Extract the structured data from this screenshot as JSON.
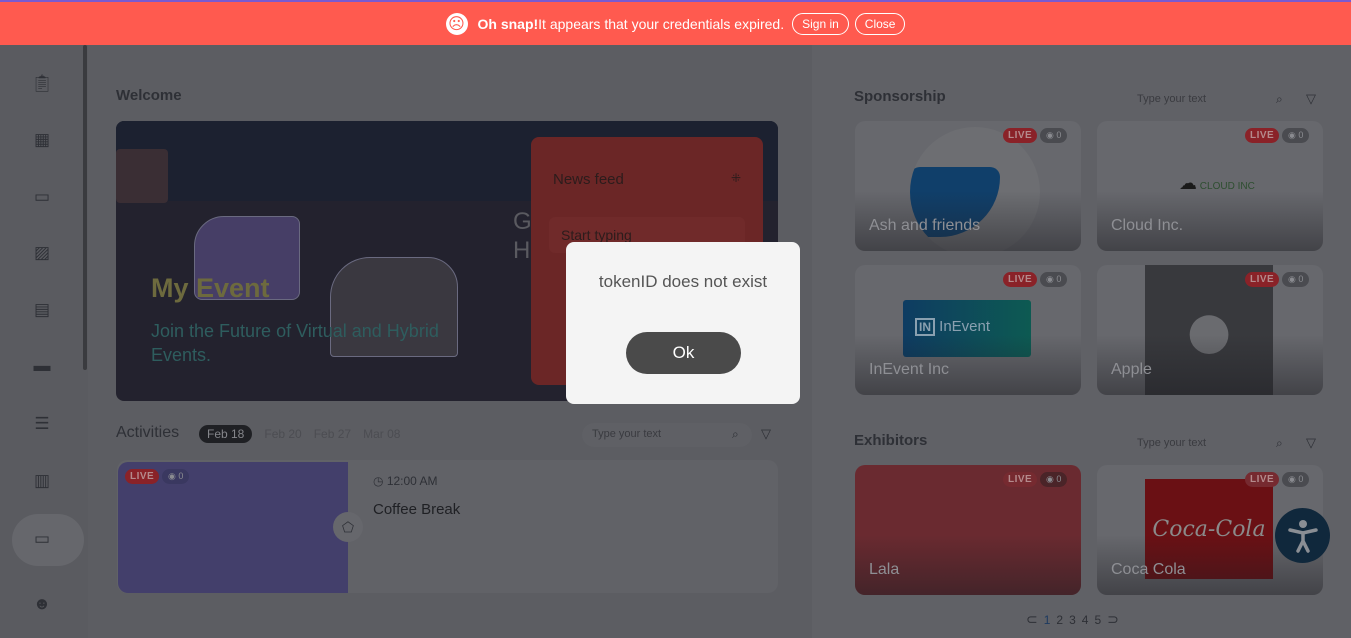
{
  "banner": {
    "strong": "Oh snap!",
    "message": " It appears that your credentials expired.",
    "sign_in": "Sign in",
    "close": "Close",
    "color": "#ff5a4f"
  },
  "sidebar": {
    "icons": [
      "clipboard-icon",
      "calendar-grid-icon",
      "calendar-icon",
      "image-icon",
      "id-card-icon",
      "ticket-icon",
      "chat-list-icon",
      "table-icon",
      "monitor-icon",
      "avatar"
    ],
    "active": "monitor-icon"
  },
  "welcome": {
    "title": "Welcome",
    "event_title": "My Event",
    "event_subtitle": "Join the Future of Virtual and Hybrid Events.",
    "partial_heading": "G\nH",
    "news_feed": {
      "title": "News feed",
      "placeholder": "Start typing"
    }
  },
  "activities": {
    "title": "Activities",
    "dates": [
      "Feb 18",
      "Feb 20",
      "Feb 27",
      "Mar 08"
    ],
    "selected_date": "Feb 18",
    "search_placeholder": "Type your text",
    "items": [
      {
        "live": "LIVE",
        "views": "0",
        "time": "12:00 AM",
        "name": "Coffee Break"
      }
    ]
  },
  "sponsorship": {
    "title": "Sponsorship",
    "search_placeholder": "Type your text",
    "cards": [
      {
        "name": "Ash and friends",
        "live": "LIVE",
        "views": "0"
      },
      {
        "name": "Cloud Inc.",
        "live": "LIVE",
        "views": "0",
        "logo": "CLOUD INC"
      },
      {
        "name": "InEvent Inc",
        "live": "LIVE",
        "views": "0",
        "logo": "InEvent"
      },
      {
        "name": "Apple",
        "live": "LIVE",
        "views": "0"
      }
    ]
  },
  "exhibitors": {
    "title": "Exhibitors",
    "search_placeholder": "Type your text",
    "cards": [
      {
        "name": "Lala",
        "live": "LIVE",
        "views": "0"
      },
      {
        "name": "Coca Cola",
        "live": "LIVE",
        "views": "0",
        "logo": "Coca-Cola"
      }
    ],
    "pagination": {
      "pages": [
        "1",
        "2",
        "3",
        "4",
        "5"
      ],
      "current": "1"
    }
  },
  "modal": {
    "message": "tokenID does not exist",
    "ok": "Ok"
  }
}
